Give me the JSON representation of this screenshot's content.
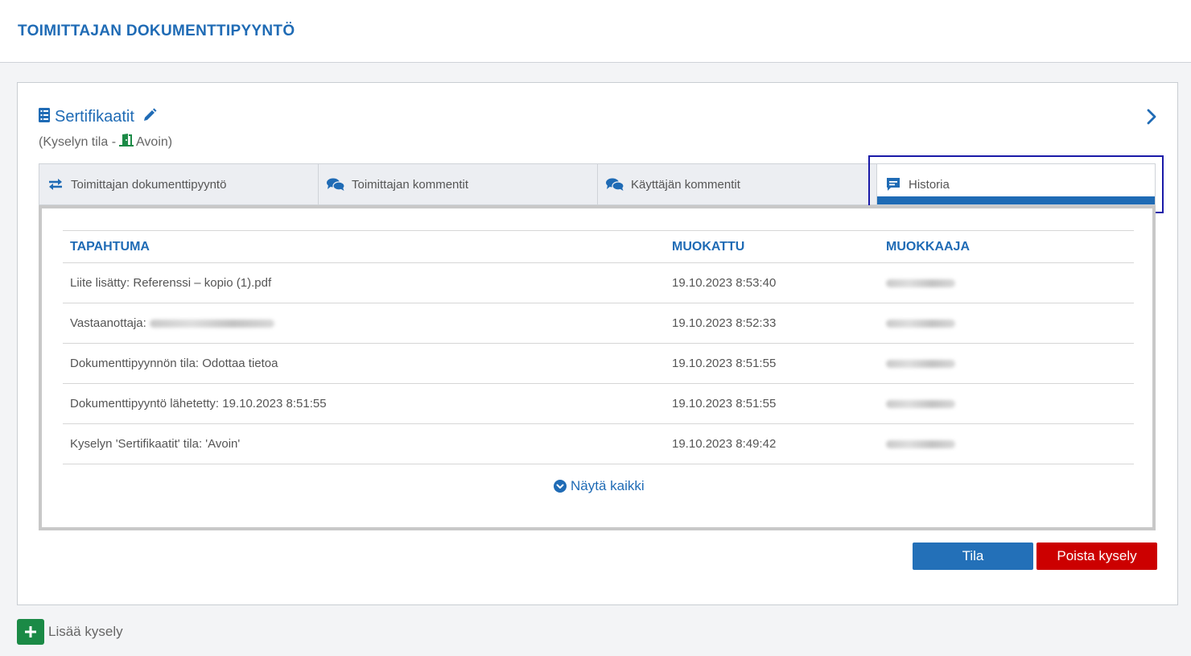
{
  "page": {
    "title": "TOIMITTAJAN DOKUMENTTIPYYNTÖ"
  },
  "card": {
    "title": "Sertifikaatit",
    "status_prefix": "(Kyselyn tila -",
    "status_value": "Avoin)",
    "icons": {
      "title": "list-icon",
      "edit": "pencil-icon",
      "status": "door-open-icon",
      "expand": "chevron-right-icon"
    }
  },
  "tabs": [
    {
      "label": "Toimittajan dokumenttipyyntö",
      "icon": "exchange-icon",
      "active": false
    },
    {
      "label": "Toimittajan kommentit",
      "icon": "comments-icon",
      "active": false
    },
    {
      "label": "Käyttäjän kommentit",
      "icon": "comments-icon",
      "active": false
    },
    {
      "label": "Historia",
      "icon": "message-icon",
      "active": true
    }
  ],
  "history_table": {
    "columns": [
      "TAPAHTUMA",
      "MUOKATTU",
      "MUOKKAAJA"
    ],
    "rows": [
      {
        "event": "Liite lisätty: Referenssi – kopio (1).pdf",
        "modified": "19.10.2023 8:53:40"
      },
      {
        "event": "Vastaanottaja:",
        "modified": "19.10.2023 8:52:33"
      },
      {
        "event": "Dokumenttipyynnön tila: Odottaa tietoa",
        "modified": "19.10.2023 8:51:55"
      },
      {
        "event": "Dokumenttipyyntö lähetetty: 19.10.2023 8:51:55",
        "modified": "19.10.2023 8:51:55"
      },
      {
        "event": "Kyselyn 'Sertifikaatit' tila: 'Avoin'",
        "modified": "19.10.2023 8:49:42"
      }
    ],
    "show_all_label": "Näytä kaikki"
  },
  "actions": {
    "status_button": "Tila",
    "delete_button": "Poista kysely"
  },
  "footer": {
    "add_query_label": "Lisää kysely"
  },
  "colors": {
    "accent": "#1f6bb5",
    "danger": "#cc0000",
    "success": "#1b8a46",
    "highlight": "#1a1aa8"
  }
}
